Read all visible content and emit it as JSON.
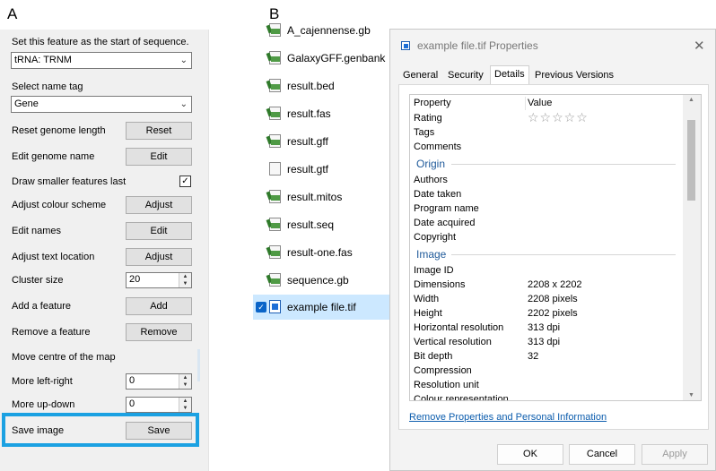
{
  "panel_labels": {
    "a": "A",
    "b": "B"
  },
  "left_panel": {
    "start_label": "Set this feature as the start of sequence.",
    "start_value": "tRNA: TRNM",
    "name_tag_label": "Select name tag",
    "name_tag_value": "Gene",
    "rows": [
      {
        "label": "Reset genome length",
        "button": "Reset"
      },
      {
        "label": "Edit genome name",
        "button": "Edit"
      },
      {
        "label": "Draw smaller features last",
        "checked": "✓"
      },
      {
        "label": "Adjust colour scheme",
        "button": "Adjust"
      },
      {
        "label": "Edit names",
        "button": "Edit"
      },
      {
        "label": "Adjust text location",
        "button": "Adjust"
      },
      {
        "label": "Cluster size",
        "spin": "20"
      },
      {
        "label": "Add a feature",
        "button": "Add"
      },
      {
        "label": "Remove a feature",
        "button": "Remove"
      },
      {
        "label": "Move centre of the map"
      },
      {
        "label": "More left-right",
        "spin": "0"
      },
      {
        "label": "More up-down",
        "spin": "0"
      },
      {
        "label": "Save image",
        "button": "Save"
      }
    ]
  },
  "explorer": {
    "files": [
      {
        "name": "A_cajennense.gb",
        "icon": "file-gb-icon"
      },
      {
        "name": "GalaxyGFF.genbank",
        "icon": "file-genbank-icon"
      },
      {
        "name": "result.bed",
        "icon": "file-bed-icon"
      },
      {
        "name": "result.fas",
        "icon": "file-fas-icon"
      },
      {
        "name": "result.gff",
        "icon": "file-gff-icon"
      },
      {
        "name": "result.gtf",
        "icon": "blank-file-icon"
      },
      {
        "name": "result.mitos",
        "icon": "file-mitos-icon"
      },
      {
        "name": "result.seq",
        "icon": "file-seq-icon"
      },
      {
        "name": "result-one.fas",
        "icon": "file-fas-icon"
      },
      {
        "name": "sequence.gb",
        "icon": "file-gb-icon"
      },
      {
        "name": "example file.tif",
        "icon": "image-file-icon",
        "selected": true
      }
    ]
  },
  "dialog": {
    "title": "example file.tif Properties",
    "close": "✕",
    "tabs": [
      "General",
      "Security",
      "Details",
      "Previous Versions"
    ],
    "active_tab": "Details",
    "col_property": "Property",
    "col_value": "Value",
    "rows_top": [
      {
        "prop": "Rating",
        "stars": "☆☆☆☆☆"
      },
      {
        "prop": "Tags"
      },
      {
        "prop": "Comments"
      }
    ],
    "section_origin": "Origin",
    "rows_origin": [
      {
        "prop": "Authors"
      },
      {
        "prop": "Date taken"
      },
      {
        "prop": "Program name"
      },
      {
        "prop": "Date acquired"
      },
      {
        "prop": "Copyright"
      }
    ],
    "section_image": "Image",
    "rows_image": [
      {
        "prop": "Image ID",
        "value": ""
      },
      {
        "prop": "Dimensions",
        "value": "2208 x 2202"
      },
      {
        "prop": "Width",
        "value": "2208 pixels"
      },
      {
        "prop": "Height",
        "value": "2202 pixels"
      },
      {
        "prop": "Horizontal resolution",
        "value": "313 dpi"
      },
      {
        "prop": "Vertical resolution",
        "value": "313 dpi"
      },
      {
        "prop": "Bit depth",
        "value": "32"
      },
      {
        "prop": "Compression",
        "value": ""
      },
      {
        "prop": "Resolution unit",
        "value": ""
      },
      {
        "prop": "Colour representation",
        "value": ""
      }
    ],
    "link": "Remove Properties and Personal Information",
    "ok": "OK",
    "cancel": "Cancel",
    "apply": "Apply"
  },
  "colors": {
    "highlight": "#1ba1e2",
    "section": "#1f5a9a",
    "link": "#0b5cad",
    "selection": "#cce8ff"
  }
}
